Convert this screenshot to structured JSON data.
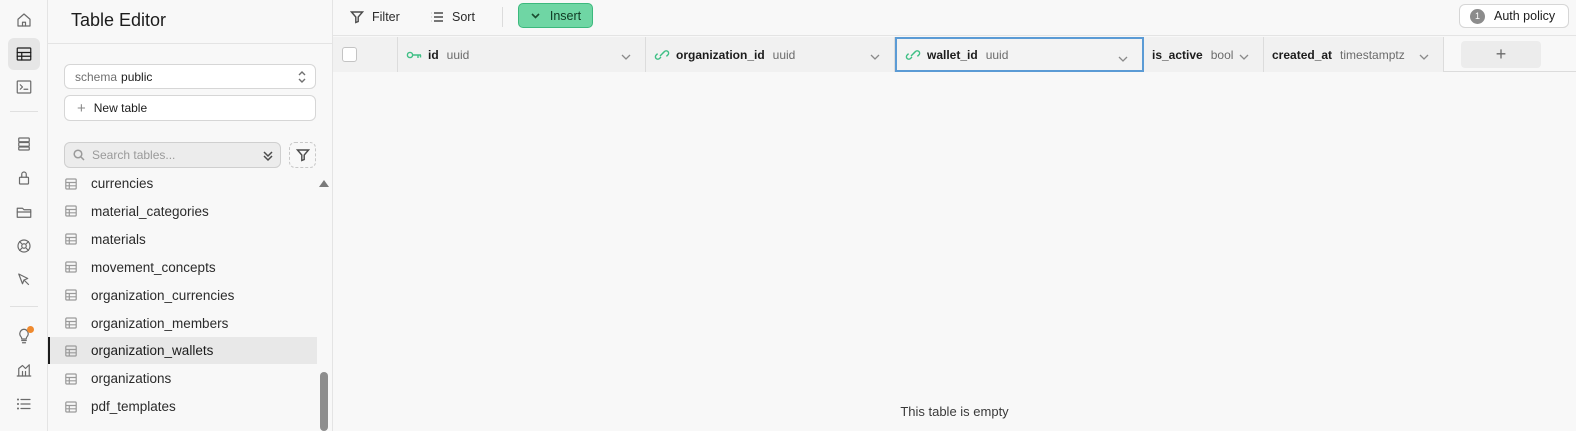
{
  "sidebar": {
    "title": "Table Editor",
    "schema": {
      "label": "schema",
      "value": "public"
    },
    "new_table_label": "New table",
    "search_placeholder": "Search tables...",
    "tables": [
      "currencies",
      "material_categories",
      "materials",
      "movement_concepts",
      "organization_currencies",
      "organization_members",
      "organization_wallets",
      "organizations",
      "pdf_templates"
    ],
    "active_table": "organization_wallets"
  },
  "toolbar": {
    "filter_label": "Filter",
    "sort_label": "Sort",
    "insert_label": "Insert",
    "auth_policy_count": "1",
    "auth_policy_label": "Auth policy"
  },
  "columns": [
    {
      "name": "id",
      "type": "uuid",
      "icon": "primary-key-icon"
    },
    {
      "name": "organization_id",
      "type": "uuid",
      "icon": "foreign-key-link-icon"
    },
    {
      "name": "wallet_id",
      "type": "uuid",
      "icon": "foreign-key-link-icon"
    },
    {
      "name": "is_active",
      "type": "bool",
      "icon": ""
    },
    {
      "name": "created_at",
      "type": "timestamptz",
      "icon": ""
    }
  ],
  "add_column_symbol": "+",
  "empty_message": "This table is empty",
  "colors": {
    "accent": "#6fd6a4",
    "focus": "#5b9bd5",
    "key_icon": "#3fbf85",
    "notification": "#ef8a2f"
  }
}
